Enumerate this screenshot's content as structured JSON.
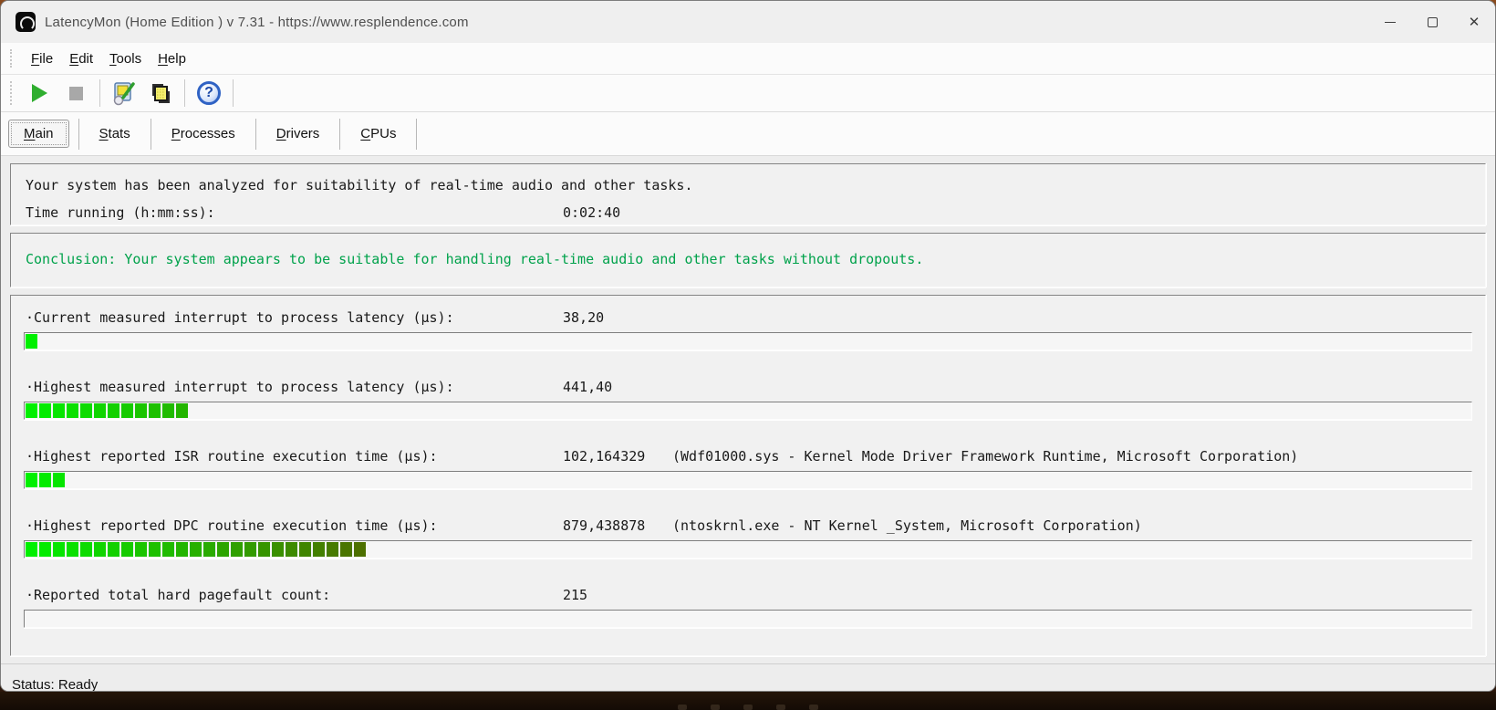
{
  "window": {
    "title": "LatencyMon  (Home Edition )  v 7.31 - https://www.resplendence.com"
  },
  "icons": {
    "close_glyph": "✕",
    "help_glyph": "?"
  },
  "menu": {
    "items": [
      {
        "key": "F",
        "rest": "ile"
      },
      {
        "key": "E",
        "rest": "dit"
      },
      {
        "key": "T",
        "rest": "ools"
      },
      {
        "key": "H",
        "rest": "elp"
      }
    ]
  },
  "tabs": [
    {
      "key": "M",
      "rest": "ain",
      "active": true
    },
    {
      "key": "S",
      "rest": "tats",
      "active": false
    },
    {
      "key": "P",
      "rest": "rocesses",
      "active": false
    },
    {
      "key": "D",
      "rest": "rivers",
      "active": false
    },
    {
      "key": "C",
      "rest": "PUs",
      "active": false
    }
  ],
  "analysis": {
    "line1": "Your system has been analyzed for suitability of real-time audio and other tasks.",
    "time_label": "Time running (h:mm:ss):",
    "time_value": "0:02:40"
  },
  "conclusion": {
    "text": "Conclusion: Your system appears to be suitable for handling real-time audio and other tasks without dropouts.",
    "color": "#00a24b"
  },
  "measurements": [
    {
      "label": "·Current measured interrupt to process latency (µs):",
      "value": "38,20",
      "note": "",
      "segments": 1
    },
    {
      "label": "·Highest measured interrupt to process latency (µs):",
      "value": "441,40",
      "note": "",
      "segments": 12
    },
    {
      "label": "·Highest reported ISR routine execution time (µs):",
      "value": "102,164329",
      "note": "(Wdf01000.sys - Kernel Mode Driver Framework Runtime, Microsoft Corporation)",
      "segments": 3
    },
    {
      "label": "·Highest reported DPC routine execution time (µs):",
      "value": "879,438878",
      "note": "(ntoskrnl.exe - NT Kernel _System, Microsoft Corporation)",
      "segments": 25
    },
    {
      "label": "·Reported total hard pagefault count:",
      "value": "215",
      "note": "",
      "segments": 0
    }
  ],
  "bar_style": {
    "segment_color_start": "#00f000",
    "segment_color_end": "#4d7000",
    "max_segments": 25
  },
  "statusbar": {
    "text": "Status: Ready"
  }
}
